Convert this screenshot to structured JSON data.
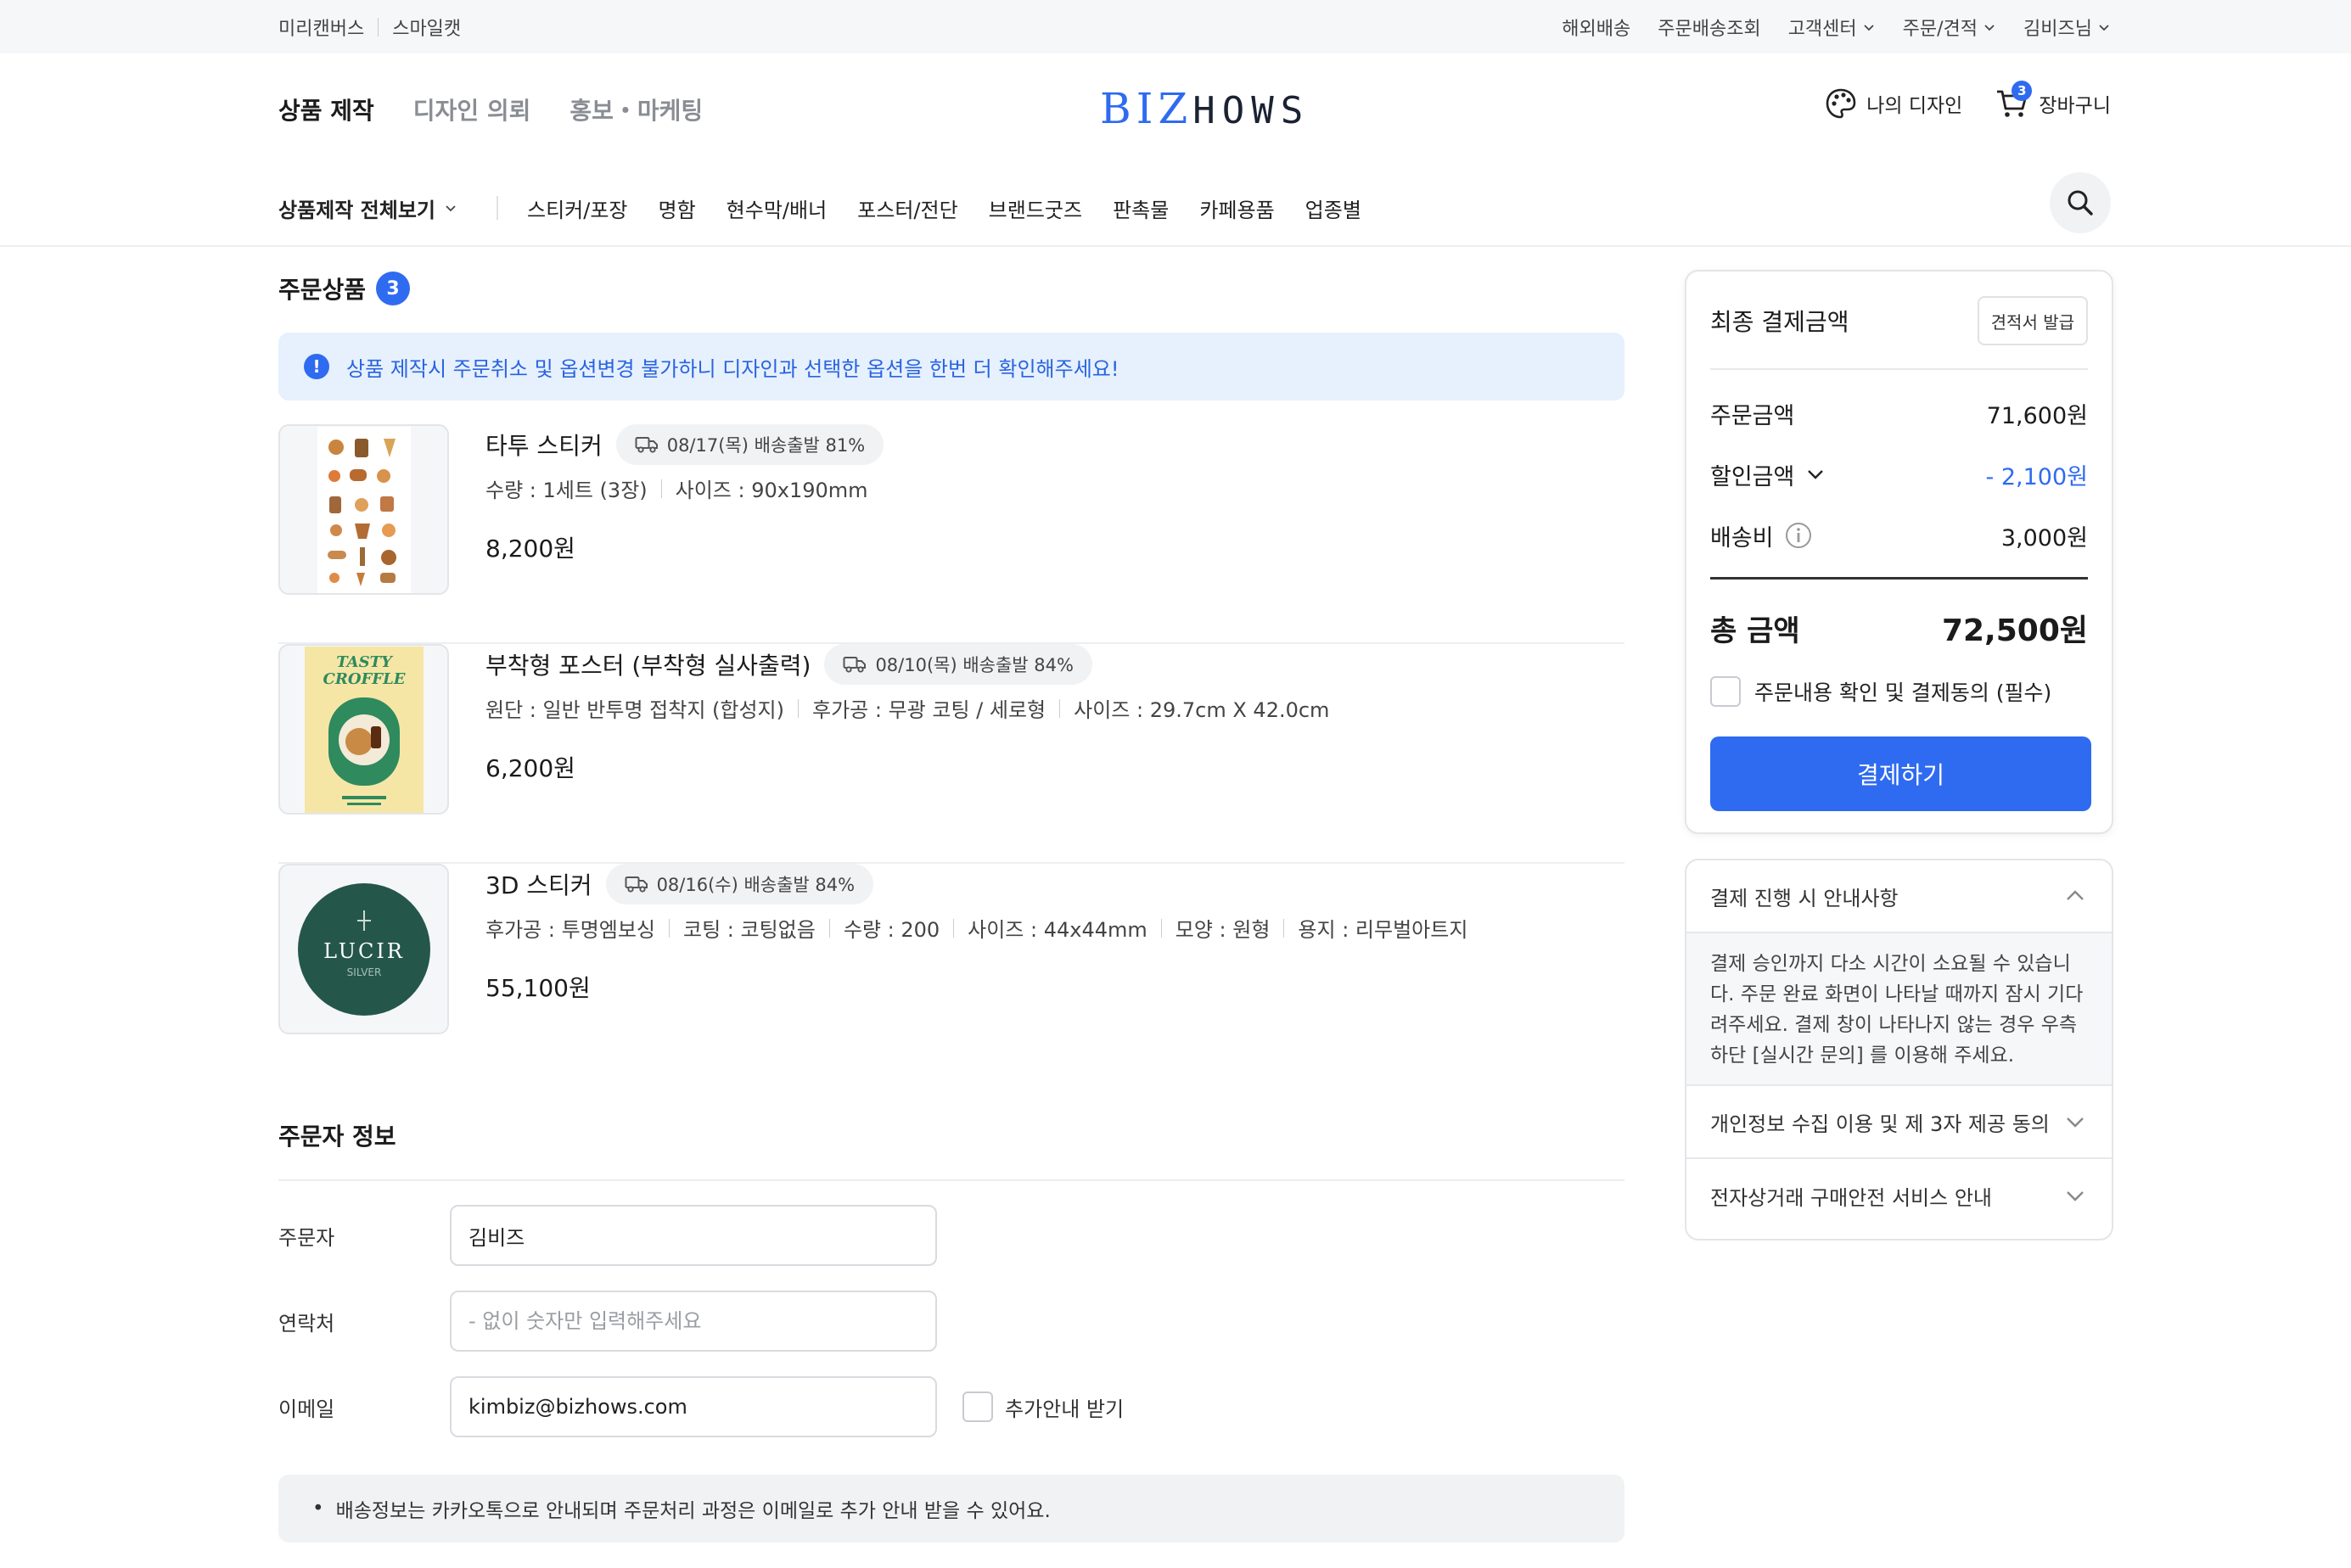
{
  "util": {
    "left": [
      "미리캔버스",
      "스마일캣"
    ],
    "right": [
      "해외배송",
      "주문배송조회"
    ],
    "right_dropdowns": [
      "고객센터",
      "주문/견적",
      "김비즈님"
    ]
  },
  "header": {
    "tabs": [
      "상품 제작",
      "디자인 의뢰",
      "홍보・마케팅"
    ],
    "logo_biz": "BIZ",
    "logo_hows": "HOWS",
    "my_design": "나의 디자인",
    "cart_label": "장바구니",
    "cart_count": "3"
  },
  "category": {
    "all": "상품제작 전체보기",
    "items": [
      "스티커/포장",
      "명함",
      "현수막/배너",
      "포스터/전단",
      "브랜드굿즈",
      "판촉물",
      "카페용품",
      "업종별"
    ]
  },
  "order": {
    "title": "주문상품",
    "count": "3",
    "notice_icon": "!",
    "notice": "상품 제작시 주문취소 및 옵션변경 불가하니 디자인과 선택한 옵션을 한번 더 확인해주세요!",
    "products": [
      {
        "name": "타투 스티커",
        "ship": "08/17(목) 배송출발 81%",
        "options": [
          "수량 : 1세트 (3장)",
          "사이즈 : 90x190mm"
        ],
        "price": "8,200원"
      },
      {
        "name": "부착형 포스터 (부착형 실사출력)",
        "ship": "08/10(목) 배송출발 84%",
        "options": [
          "원단 : 일반 반투명 접착지 (합성지)",
          "후가공 : 무광 코팅 / 세로형",
          "사이즈 : 29.7cm X 42.0cm"
        ],
        "price": "6,200원",
        "thumb_text": [
          "TASTY",
          "CROFFLE"
        ]
      },
      {
        "name": "3D 스티커",
        "ship": "08/16(수) 배송출발 84%",
        "options": [
          "후가공 : 투명엠보싱",
          "코팅 : 코팅없음",
          "수량 : 200",
          "사이즈 : 44x44mm",
          "모양 : 원형",
          "용지 : 리무벌아트지"
        ],
        "price": "55,100원",
        "thumb_text": [
          "LUCIR",
          "SILVER"
        ]
      }
    ]
  },
  "orderer": {
    "title": "주문자 정보",
    "name_label": "주문자",
    "name_value": "김비즈",
    "phone_label": "연락처",
    "phone_placeholder": "- 없이 숫자만 입력해주세요",
    "email_label": "이메일",
    "email_value": "kimbiz@bizhows.com",
    "extra_label": "추가안내 받기",
    "info": "배송정보는 카카오톡으로 안내되며 주문처리 과정은 이메일로 추가 안내 받을 수 있어요.",
    "info_bullet": "•"
  },
  "payment": {
    "title": "최종 결제금액",
    "quote_button": "견적서 발급",
    "order_amount_label": "주문금액",
    "order_amount": "71,600원",
    "discount_label": "할인금액",
    "discount": "- 2,100원",
    "shipping_label": "배송비",
    "shipping": "3,000원",
    "total_label": "총 금액",
    "total": "72,500원",
    "agree_label": "주문내용 확인 및 결제동의 (필수)",
    "pay_button": "결제하기"
  },
  "guide": {
    "title": "결제 진행 시 안내사항",
    "body": "결제 승인까지 다소 시간이 소요될 수 있습니다. 주문 완료 화면이 나타날 때까지 잠시 기다려주세요. 결제 창이 나타나지 않는 경우 우측 하단 [실시간 문의] 를 이용해 주세요.",
    "privacy": "개인정보 수집 이용 및 제 3자 제공 동의",
    "safety": "전자상거래 구매안전 서비스 안내"
  },
  "colors": {
    "accent": "#2f6bf0",
    "notice_bg": "#e6f1fd"
  }
}
